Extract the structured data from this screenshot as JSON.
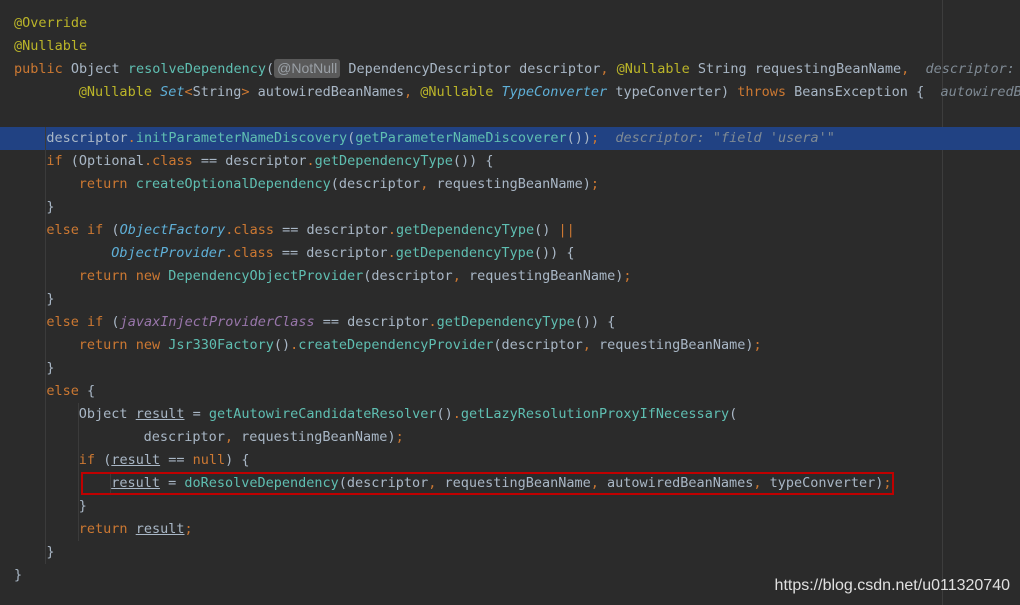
{
  "editor": {
    "current_line_index": 5,
    "highlighted_line_index": 20,
    "colors": {
      "background": "#2b2b2b",
      "current_line": "#214283",
      "keyword": "#cc7832",
      "annotation": "#bbb529",
      "method": "#ffc66d",
      "highlight_box": "#c00000"
    },
    "lines": [
      {
        "indent": 0,
        "tokens": [
          {
            "t": "@Override",
            "c": "ann"
          }
        ]
      },
      {
        "indent": 0,
        "tokens": [
          {
            "t": "@Nullable",
            "c": "ann"
          }
        ]
      },
      {
        "indent": 0,
        "tokens": [
          {
            "t": "public ",
            "c": "kw"
          },
          {
            "t": "Object ",
            "c": "ty"
          },
          {
            "t": "resolveDependency",
            "c": "mc"
          },
          {
            "t": "(",
            "c": "pn"
          },
          {
            "t": "@NotNull",
            "c": "badge"
          },
          {
            "t": " DependencyDescriptor ",
            "c": "ty"
          },
          {
            "t": "descriptor",
            "c": "pn"
          },
          {
            "t": ", ",
            "c": "kw"
          },
          {
            "t": "@Nullable ",
            "c": "ann"
          },
          {
            "t": "String ",
            "c": "ty"
          },
          {
            "t": "requestingBeanName",
            "c": "pn"
          },
          {
            "t": ",  ",
            "c": "kw"
          },
          {
            "t": "descriptor: \"",
            "c": "hint"
          }
        ]
      },
      {
        "indent": 8,
        "tokens": [
          {
            "t": "@Nullable ",
            "c": "ann"
          },
          {
            "t": "Set",
            "c": "tyi"
          },
          {
            "t": "<",
            "c": "kw"
          },
          {
            "t": "String",
            "c": "ty"
          },
          {
            "t": "> ",
            "c": "kw"
          },
          {
            "t": "autowiredBeanNames",
            "c": "pn"
          },
          {
            "t": ", ",
            "c": "kw"
          },
          {
            "t": "@Nullable ",
            "c": "ann"
          },
          {
            "t": "TypeConverter ",
            "c": "tyi"
          },
          {
            "t": "typeConverter) ",
            "c": "pn"
          },
          {
            "t": "throws ",
            "c": "kw"
          },
          {
            "t": "BeansException ",
            "c": "ty"
          },
          {
            "t": "{  ",
            "c": "pn"
          },
          {
            "t": "autowiredBea",
            "c": "hint"
          }
        ]
      },
      {
        "indent": 0,
        "tokens": []
      },
      {
        "indent": 4,
        "tokens": [
          {
            "t": "descriptor",
            "c": "pn"
          },
          {
            "t": ".",
            "c": "kw"
          },
          {
            "t": "initParameterNameDiscovery",
            "c": "mc"
          },
          {
            "t": "(",
            "c": "pn"
          },
          {
            "t": "getParameterNameDiscoverer",
            "c": "mc"
          },
          {
            "t": "())",
            "c": "pn"
          },
          {
            "t": ";  ",
            "c": "kw"
          },
          {
            "t": "descriptor: \"field 'usera'\"",
            "c": "hint"
          }
        ]
      },
      {
        "indent": 4,
        "tokens": [
          {
            "t": "if ",
            "c": "kw"
          },
          {
            "t": "(",
            "c": "pn"
          },
          {
            "t": "Optional",
            "c": "ty"
          },
          {
            "t": ".class ",
            "c": "kw"
          },
          {
            "t": "== descriptor",
            "c": "pn"
          },
          {
            "t": ".",
            "c": "kw"
          },
          {
            "t": "getDependencyType",
            "c": "mc"
          },
          {
            "t": "()) {",
            "c": "pn"
          }
        ]
      },
      {
        "indent": 8,
        "tokens": [
          {
            "t": "return ",
            "c": "kw"
          },
          {
            "t": "createOptionalDependency",
            "c": "mc"
          },
          {
            "t": "(descriptor",
            "c": "pn"
          },
          {
            "t": ", ",
            "c": "kw"
          },
          {
            "t": "requestingBeanName)",
            "c": "pn"
          },
          {
            "t": ";",
            "c": "kw"
          }
        ]
      },
      {
        "indent": 4,
        "tokens": [
          {
            "t": "}",
            "c": "pn"
          }
        ]
      },
      {
        "indent": 4,
        "tokens": [
          {
            "t": "else if ",
            "c": "kw"
          },
          {
            "t": "(",
            "c": "pn"
          },
          {
            "t": "ObjectFactory",
            "c": "tyi"
          },
          {
            "t": ".class ",
            "c": "kw"
          },
          {
            "t": "== descriptor",
            "c": "pn"
          },
          {
            "t": ".",
            "c": "kw"
          },
          {
            "t": "getDependencyType",
            "c": "mc"
          },
          {
            "t": "() ",
            "c": "pn"
          },
          {
            "t": "||",
            "c": "kw"
          }
        ]
      },
      {
        "indent": 12,
        "tokens": [
          {
            "t": "ObjectProvider",
            "c": "tyi"
          },
          {
            "t": ".class ",
            "c": "kw"
          },
          {
            "t": "== descriptor",
            "c": "pn"
          },
          {
            "t": ".",
            "c": "kw"
          },
          {
            "t": "getDependencyType",
            "c": "mc"
          },
          {
            "t": "()) {",
            "c": "pn"
          }
        ]
      },
      {
        "indent": 8,
        "tokens": [
          {
            "t": "return new ",
            "c": "kw"
          },
          {
            "t": "DependencyObjectProvider",
            "c": "mc"
          },
          {
            "t": "(descriptor",
            "c": "pn"
          },
          {
            "t": ", ",
            "c": "kw"
          },
          {
            "t": "requestingBeanName)",
            "c": "pn"
          },
          {
            "t": ";",
            "c": "kw"
          }
        ]
      },
      {
        "indent": 4,
        "tokens": [
          {
            "t": "}",
            "c": "pn"
          }
        ]
      },
      {
        "indent": 4,
        "tokens": [
          {
            "t": "else if ",
            "c": "kw"
          },
          {
            "t": "(",
            "c": "pn"
          },
          {
            "t": "javaxInjectProviderClass ",
            "c": "fld"
          },
          {
            "t": "== descriptor",
            "c": "pn"
          },
          {
            "t": ".",
            "c": "kw"
          },
          {
            "t": "getDependencyType",
            "c": "mc"
          },
          {
            "t": "()) {",
            "c": "pn"
          }
        ]
      },
      {
        "indent": 8,
        "tokens": [
          {
            "t": "return new ",
            "c": "kw"
          },
          {
            "t": "Jsr330Factory",
            "c": "mc"
          },
          {
            "t": "()",
            "c": "pn"
          },
          {
            "t": ".",
            "c": "kw"
          },
          {
            "t": "createDependencyProvider",
            "c": "mc"
          },
          {
            "t": "(descriptor",
            "c": "pn"
          },
          {
            "t": ", ",
            "c": "kw"
          },
          {
            "t": "requestingBeanName)",
            "c": "pn"
          },
          {
            "t": ";",
            "c": "kw"
          }
        ]
      },
      {
        "indent": 4,
        "tokens": [
          {
            "t": "}",
            "c": "pn"
          }
        ]
      },
      {
        "indent": 4,
        "tokens": [
          {
            "t": "else ",
            "c": "kw"
          },
          {
            "t": "{",
            "c": "pn"
          }
        ]
      },
      {
        "indent": 8,
        "tokens": [
          {
            "t": "Object ",
            "c": "ty"
          },
          {
            "t": "result",
            "c": "ul"
          },
          {
            "t": " = ",
            "c": "pn"
          },
          {
            "t": "getAutowireCandidateResolver",
            "c": "mc"
          },
          {
            "t": "()",
            "c": "pn"
          },
          {
            "t": ".",
            "c": "kw"
          },
          {
            "t": "getLazyResolutionProxyIfNecessary",
            "c": "mc"
          },
          {
            "t": "(",
            "c": "pn"
          }
        ]
      },
      {
        "indent": 16,
        "tokens": [
          {
            "t": "descriptor",
            "c": "pn"
          },
          {
            "t": ", ",
            "c": "kw"
          },
          {
            "t": "requestingBeanName)",
            "c": "pn"
          },
          {
            "t": ";",
            "c": "kw"
          }
        ]
      },
      {
        "indent": 8,
        "tokens": [
          {
            "t": "if ",
            "c": "kw"
          },
          {
            "t": "(",
            "c": "pn"
          },
          {
            "t": "result",
            "c": "ul"
          },
          {
            "t": " == ",
            "c": "pn"
          },
          {
            "t": "null",
            "c": "kw"
          },
          {
            "t": ") {",
            "c": "pn"
          }
        ]
      },
      {
        "indent": 12,
        "tokens": [
          {
            "t": "result",
            "c": "ul"
          },
          {
            "t": " = ",
            "c": "pn"
          },
          {
            "t": "doResolveDependency",
            "c": "mc"
          },
          {
            "t": "(descriptor",
            "c": "pn"
          },
          {
            "t": ", ",
            "c": "kw"
          },
          {
            "t": "requestingBeanName",
            "c": "pn"
          },
          {
            "t": ", ",
            "c": "kw"
          },
          {
            "t": "autowiredBeanNames",
            "c": "pn"
          },
          {
            "t": ", ",
            "c": "kw"
          },
          {
            "t": "typeConverter)",
            "c": "pn"
          },
          {
            "t": ";",
            "c": "kw"
          }
        ]
      },
      {
        "indent": 8,
        "tokens": [
          {
            "t": "}",
            "c": "pn"
          }
        ]
      },
      {
        "indent": 8,
        "tokens": [
          {
            "t": "return ",
            "c": "kw"
          },
          {
            "t": "result",
            "c": "ul"
          },
          {
            "t": ";",
            "c": "kw"
          }
        ]
      },
      {
        "indent": 4,
        "tokens": [
          {
            "t": "}",
            "c": "pn"
          }
        ]
      },
      {
        "indent": 0,
        "tokens": [
          {
            "t": "}",
            "c": "pn"
          }
        ]
      }
    ]
  },
  "watermark": "https://blog.csdn.net/u011320740"
}
